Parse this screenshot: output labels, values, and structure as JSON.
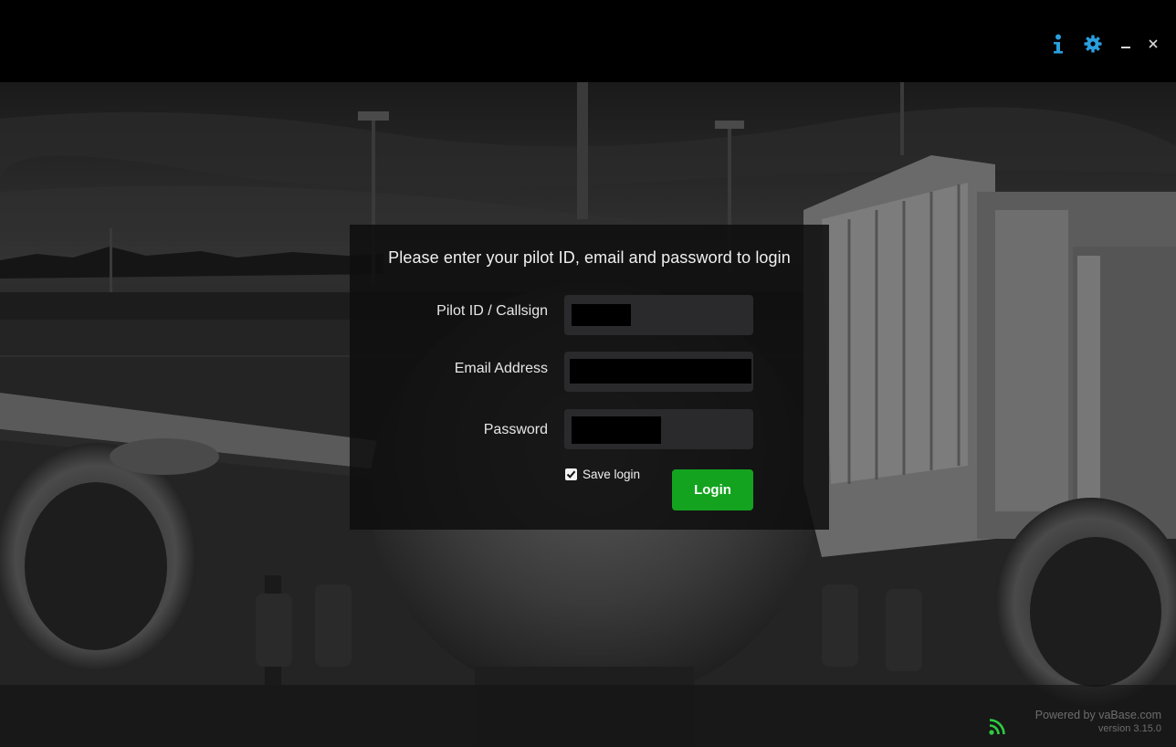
{
  "titlebar": {
    "icons": [
      "info-icon",
      "gear-icon",
      "minimize-icon",
      "close-icon"
    ],
    "accent_color": "#2a9fe0"
  },
  "login": {
    "title": "Please enter your pilot ID, email and password to login",
    "pilot_id_label": "Pilot ID / Callsign",
    "email_label": "Email Address",
    "password_label": "Password",
    "save_login_label": "Save login",
    "save_login_checked": true,
    "login_button_label": "Login",
    "login_button_color": "#13a31f"
  },
  "footer": {
    "powered_by": "Powered by vaBase.com",
    "version": "version 3.15.0",
    "status_icon": "rss-icon",
    "status_color": "#2ecc40"
  }
}
